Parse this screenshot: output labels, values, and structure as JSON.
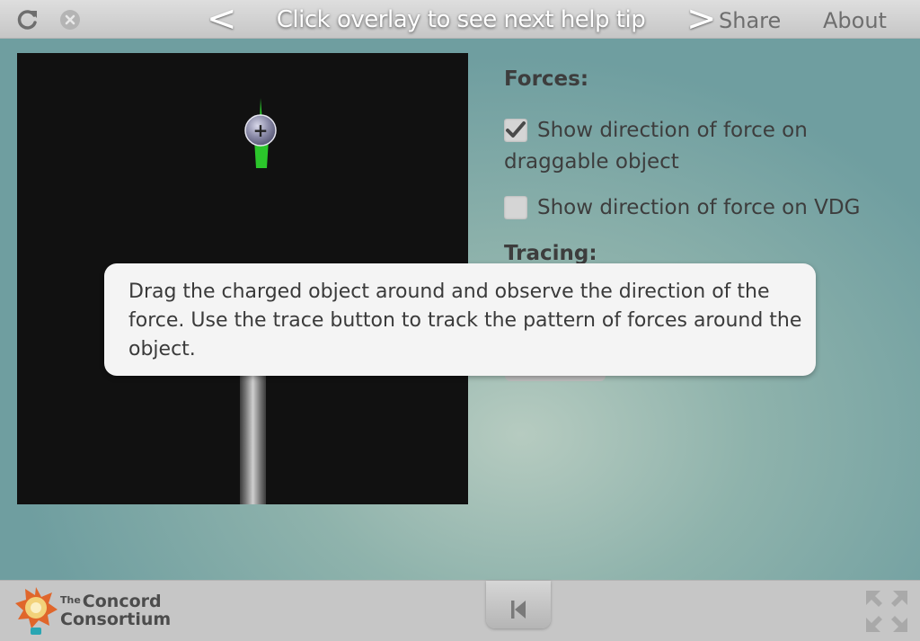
{
  "topbar": {
    "reload_icon": "reload-icon",
    "close_icon": "close-icon",
    "prev_glyph": "<",
    "next_glyph": ">",
    "help_text": "Click overlay to see next help tip",
    "share_label": "Share",
    "about_label": "About"
  },
  "panel": {
    "forces_heading": "Forces:",
    "options": [
      {
        "label": "Show direction of force on draggable object",
        "checked": true
      },
      {
        "label": "Show direction of force on VDG",
        "checked": false
      }
    ],
    "tracing_heading": "Tracing:"
  },
  "canvas": {
    "charge_symbol": "+",
    "force_arrow_color": "#2bc52b"
  },
  "overlay": {
    "text": "Drag the charged object around and observe the direction of the force. Use the trace button to track the pattern of forces around the object."
  },
  "footer": {
    "logo_small": "The",
    "logo_line1": "Concord",
    "logo_line2": "Consortium",
    "reset_icon": "reset-to-start-icon",
    "fullscreen_icon": "fullscreen-icon"
  }
}
